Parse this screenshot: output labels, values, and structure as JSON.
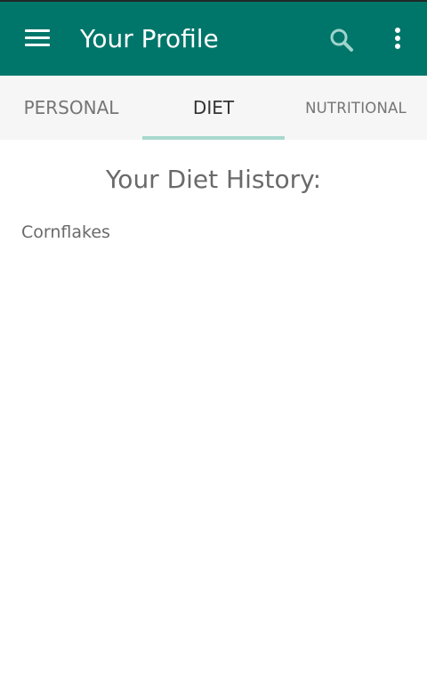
{
  "app_bar": {
    "menu_icon": "menu-icon",
    "title": "Your Profile",
    "search_icon": "search-icon",
    "more_icon": "more-vert-icon",
    "background_color": "#00766a"
  },
  "tabs": [
    {
      "label": "PERSONAL",
      "selected": false
    },
    {
      "label": "DIET",
      "selected": true
    },
    {
      "label": "NUTRITIONAL",
      "selected": false
    }
  ],
  "tab_indicator_color": "#a8d8cf",
  "main": {
    "heading": "Your Diet History:",
    "diet_items": [
      "Cornflakes"
    ]
  }
}
